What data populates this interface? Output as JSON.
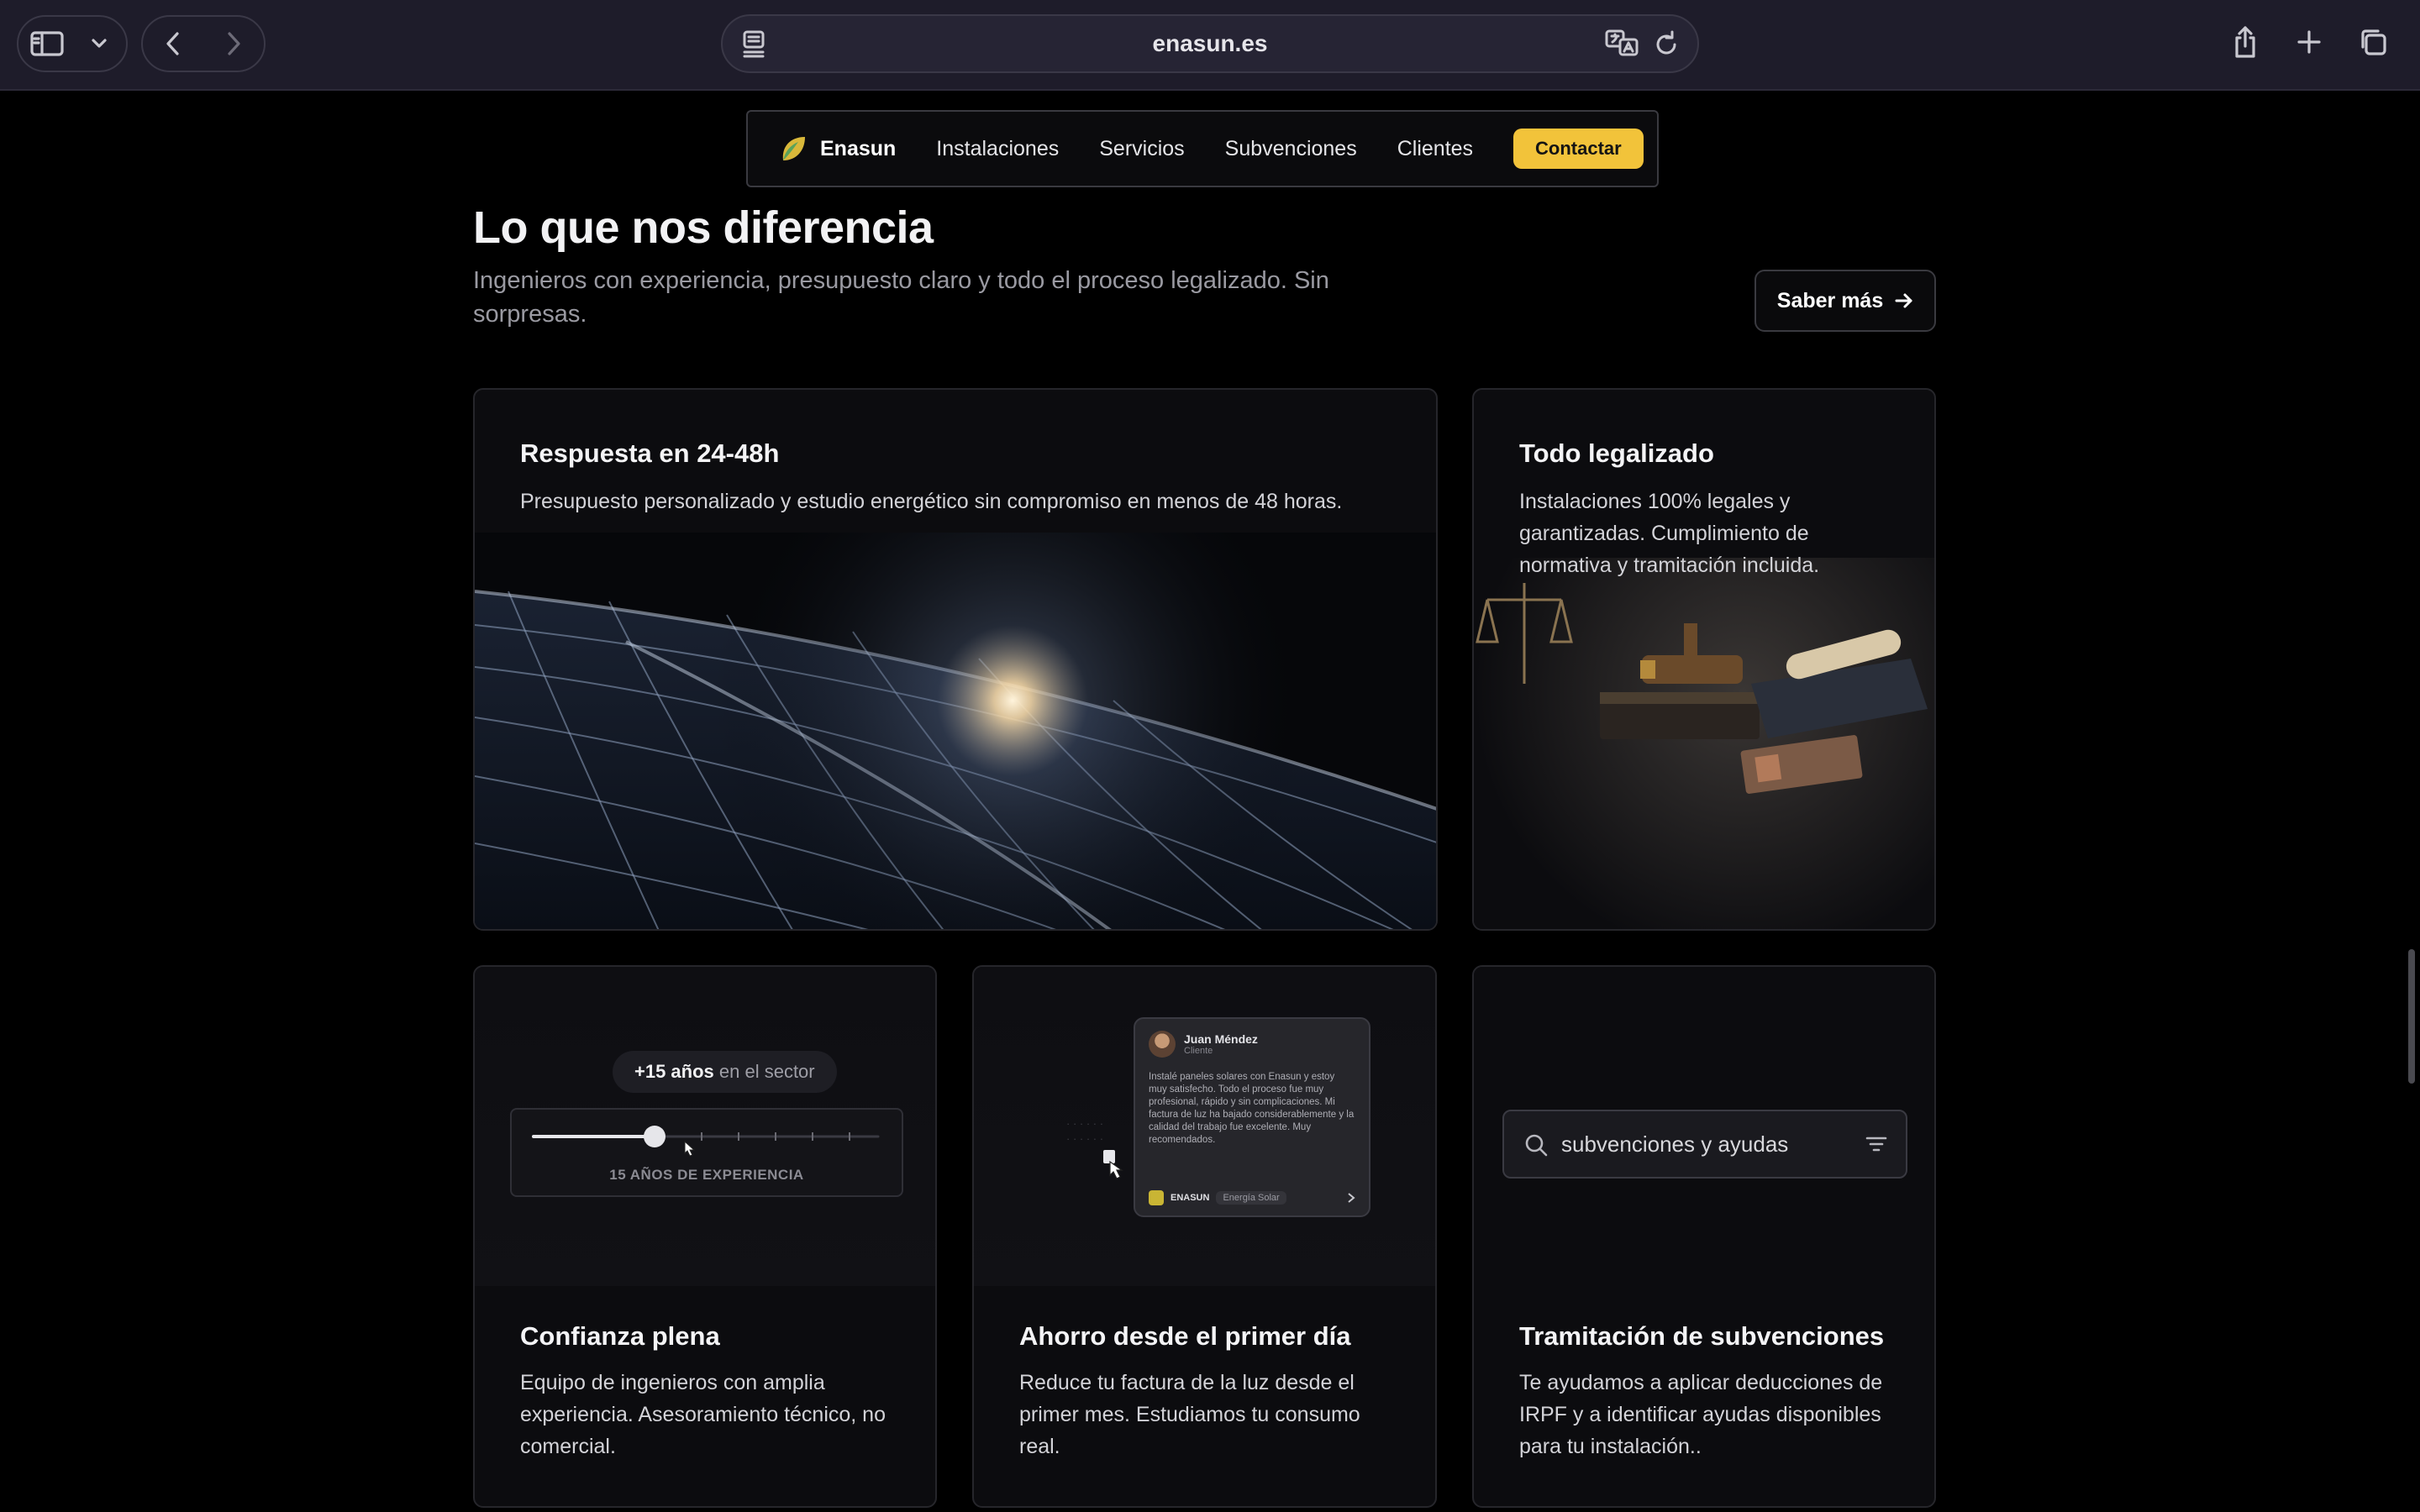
{
  "browser": {
    "url": "enasun.es"
  },
  "nav": {
    "brand": "Enasun",
    "links": [
      "Instalaciones",
      "Servicios",
      "Subvenciones",
      "Clientes"
    ],
    "cta": "Contactar"
  },
  "section": {
    "title": "Lo que nos diferencia",
    "subtitle": "Ingenieros con experiencia, presupuesto claro y todo el proceso legalizado. Sin sorpresas.",
    "more_button": "Saber más"
  },
  "cards": [
    {
      "title": "Respuesta en 24-48h",
      "text": "Presupuesto personalizado y estudio energético sin compromiso en menos de 48 horas."
    },
    {
      "title": "Todo legalizado",
      "text": "Instalaciones 100% legales y garantizadas. Cumplimiento de normativa y tramitación incluida."
    },
    {
      "title": "Confianza plena",
      "text": "Equipo de ingenieros con amplia experiencia. Asesoramiento técnico, no comercial.",
      "widget": {
        "pill_strong": "+15 años",
        "pill_rest": " en el sector",
        "caption": "15 AÑOS DE EXPERIENCIA",
        "slider_value_years": 15
      }
    },
    {
      "title": "Ahorro desde el primer día",
      "text": "Reduce tu factura de la luz desde el primer mes. Estudiamos tu consumo real.",
      "testimonial": {
        "name": "Juan Méndez",
        "role": "Cliente",
        "body": "Instalé paneles solares con Enasun y estoy muy satisfecho. Todo el proceso fue muy profesional, rápido y sin complicaciones. Mi factura de luz ha bajado considerablemente y la calidad del trabajo fue excelente. Muy recomendados.",
        "brand": "ENASUN",
        "tag": "Energía Solar"
      }
    },
    {
      "title": "Tramitación de subvenciones",
      "text": "Te ayudamos a aplicar deducciones de IRPF y a identificar ayudas disponibles para tu instalación..",
      "search_value": "subvenciones y ayudas"
    }
  ],
  "colors": {
    "accent": "#f2c33a",
    "background": "#000000",
    "card": "#0c0c0f"
  }
}
